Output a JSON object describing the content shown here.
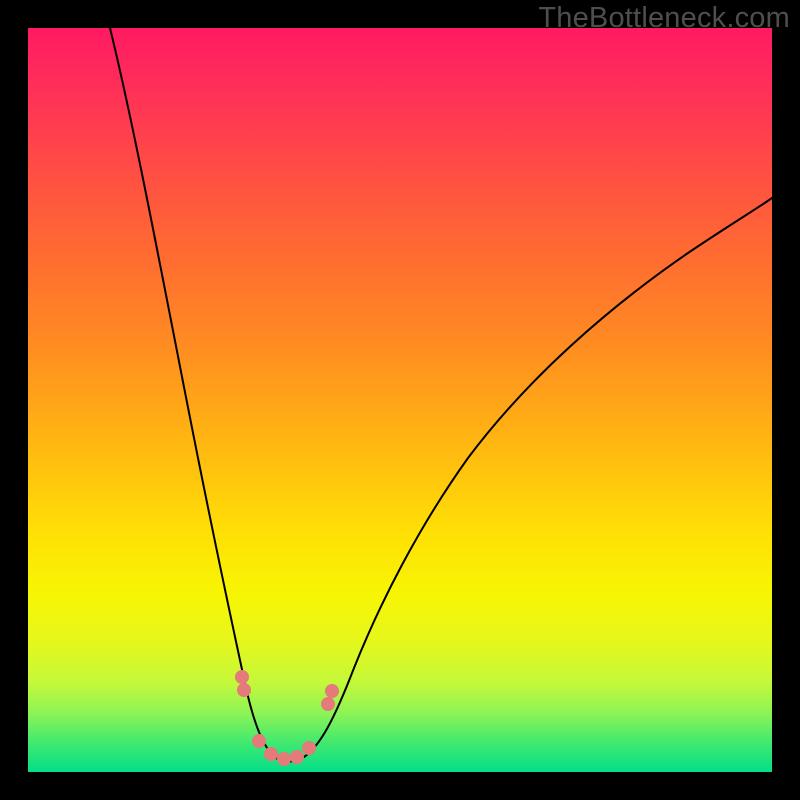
{
  "watermark": "TheBottleneck.com",
  "colors": {
    "frame_border": "#000000",
    "gradient_top": "#ff1a62",
    "gradient_mid": "#ffe005",
    "gradient_bottom": "#03de89",
    "curve_stroke": "#000000",
    "dot_fill": "#e47a7a"
  },
  "chart_data": {
    "type": "line",
    "title": "",
    "xlabel": "",
    "ylabel": "",
    "x_range": [
      0,
      100
    ],
    "y_range": [
      0,
      100
    ],
    "note": "Background encodes bottleneck severity (red high, green low). Curve is a V-shaped bottleneck profile with minimum near x≈33.",
    "series": [
      {
        "name": "bottleneck-curve",
        "points": [
          {
            "x": 11,
            "y": 100
          },
          {
            "x": 15,
            "y": 78
          },
          {
            "x": 19,
            "y": 57
          },
          {
            "x": 23,
            "y": 38
          },
          {
            "x": 26,
            "y": 24
          },
          {
            "x": 28,
            "y": 15
          },
          {
            "x": 30,
            "y": 8
          },
          {
            "x": 32,
            "y": 3
          },
          {
            "x": 33,
            "y": 1.5
          },
          {
            "x": 35,
            "y": 1.5
          },
          {
            "x": 37,
            "y": 3
          },
          {
            "x": 40,
            "y": 8
          },
          {
            "x": 44,
            "y": 16
          },
          {
            "x": 50,
            "y": 27
          },
          {
            "x": 58,
            "y": 38
          },
          {
            "x": 68,
            "y": 49
          },
          {
            "x": 80,
            "y": 59
          },
          {
            "x": 92,
            "y": 67
          },
          {
            "x": 100,
            "y": 72
          }
        ]
      }
    ],
    "markers": [
      {
        "name": "left-pair-upper",
        "x": 28.5,
        "y": 13
      },
      {
        "name": "left-pair-lower",
        "x": 28.5,
        "y": 11
      },
      {
        "name": "bottom-1",
        "x": 31,
        "y": 3.5
      },
      {
        "name": "bottom-2",
        "x": 32.5,
        "y": 2
      },
      {
        "name": "bottom-3",
        "x": 34,
        "y": 1.5
      },
      {
        "name": "bottom-4",
        "x": 35.5,
        "y": 1.8
      },
      {
        "name": "bottom-5",
        "x": 37,
        "y": 2.7
      },
      {
        "name": "right-pair-lower",
        "x": 40,
        "y": 9
      },
      {
        "name": "right-pair-upper",
        "x": 40.5,
        "y": 11
      }
    ]
  }
}
